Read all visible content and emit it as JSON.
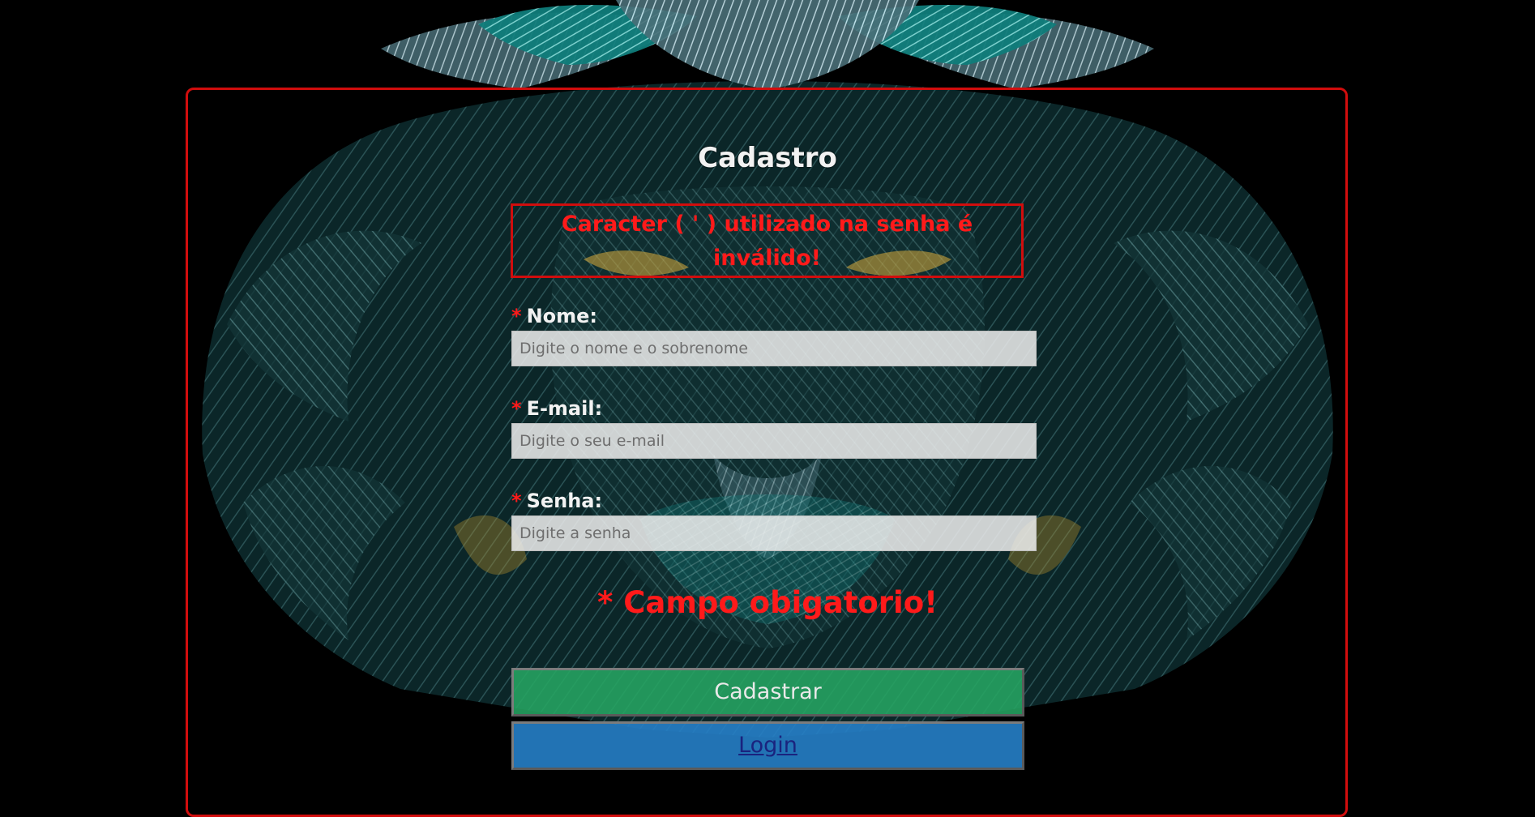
{
  "form": {
    "title": "Cadastro",
    "error_message": "Caracter ( ' ) utilizado na senha é inválido!",
    "fields": [
      {
        "required_mark": "*",
        "label": "Nome:",
        "placeholder": "Digite o nome e o sobrenome",
        "value": ""
      },
      {
        "required_mark": "*",
        "label": "E-mail:",
        "placeholder": "Digite o seu e-mail",
        "value": ""
      },
      {
        "required_mark": "*",
        "label": "Senha:",
        "placeholder": "Digite a senha",
        "value": ""
      }
    ],
    "required_note": "* Campo obigatorio!",
    "register_button": "Cadastrar",
    "login_link": "Login"
  },
  "colors": {
    "background": "#000000",
    "border_red": "#d10d0d",
    "error_text": "#ff1a1a",
    "register_green": "#26a562",
    "login_blue": "#2680c8"
  },
  "background_image": {
    "icon": "tribal-lion-face-artwork"
  }
}
